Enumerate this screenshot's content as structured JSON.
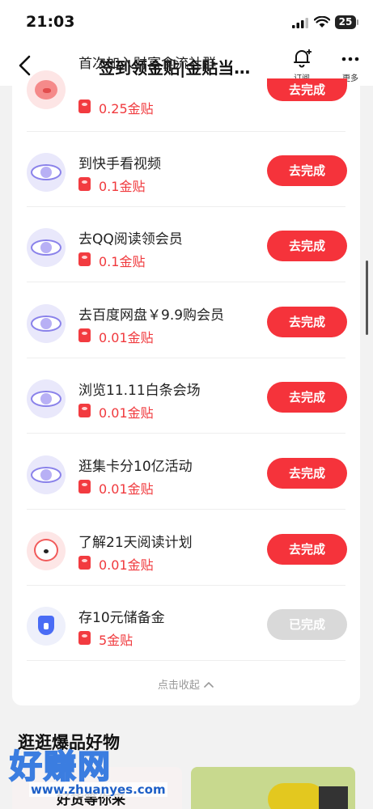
{
  "status": {
    "time": "21:03",
    "battery": "25"
  },
  "nav": {
    "title": "签到领金贴|金贴当…",
    "subscribe_label": "订阅",
    "more_label": "更多"
  },
  "tasks": [
    {
      "title": "首次加入财富食流社群",
      "reward": "0.25金贴",
      "button": "去完成",
      "icon": "piggy-bank-icon"
    },
    {
      "title": "到快手看视频",
      "reward": "0.1金贴",
      "button": "去完成",
      "icon": "eye-icon"
    },
    {
      "title": "去QQ阅读领会员",
      "reward": "0.1金贴",
      "button": "去完成",
      "icon": "eye-icon"
    },
    {
      "title": "去百度网盘￥9.9购会员",
      "reward": "0.01金贴",
      "button": "去完成",
      "icon": "eye-icon"
    },
    {
      "title": "浏览11.11白条会场",
      "reward": "0.01金贴",
      "button": "去完成",
      "icon": "eye-icon"
    },
    {
      "title": "逛集卡分10亿活动",
      "reward": "0.01金贴",
      "button": "去完成",
      "icon": "eye-icon"
    },
    {
      "title": "了解21天阅读计划",
      "reward": "0.01金贴",
      "button": "去完成",
      "icon": "joy-dog-icon"
    },
    {
      "title": "存10元储备金",
      "reward": "5金贴",
      "button": "已完成",
      "icon": "shield-umbrella-icon"
    }
  ],
  "collapse_label": "点击收起",
  "section": {
    "title": "逛逛爆品好物",
    "banner_text": "好货等你来"
  },
  "watermark": {
    "brand": "好赚网",
    "url": "www.zhuanyes.com"
  },
  "colors": {
    "accent": "#f5333b",
    "reward_red": "#f0393d",
    "disabled": "#d9d9d9"
  }
}
